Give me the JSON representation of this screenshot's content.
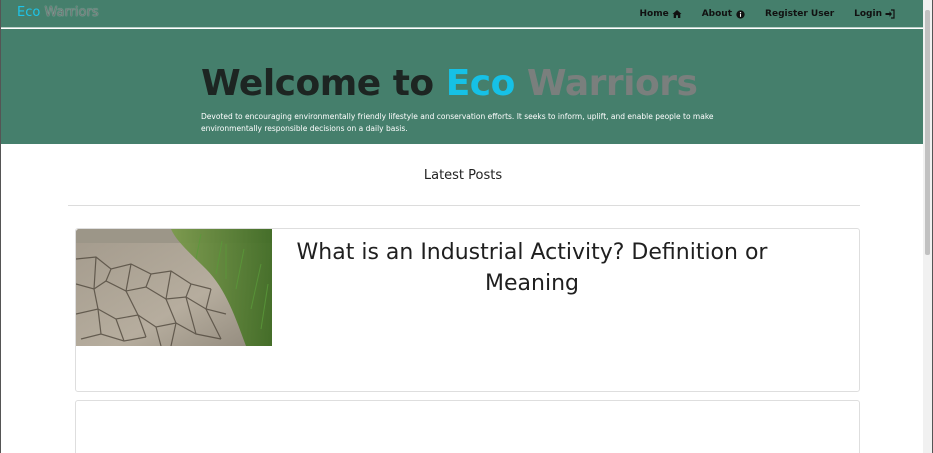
{
  "navbar": {
    "brand_part1": "Eco",
    "brand_part2": "Warriors",
    "links": [
      {
        "label": "Home",
        "icon": "home-icon"
      },
      {
        "label": "About",
        "icon": "info-icon"
      },
      {
        "label": "Register User",
        "icon": ""
      },
      {
        "label": "Login",
        "icon": "login-icon"
      }
    ]
  },
  "hero": {
    "title_part1": "Welcome to",
    "title_part2": "Eco",
    "title_part3": "Warriors",
    "description": "Devoted to encouraging environmentally friendly lifestyle and conservation efforts. It seeks to inform, uplift, and enable people to make environmentally responsible decisions on a daily basis."
  },
  "main": {
    "section_title": "Latest Posts",
    "posts": [
      {
        "title": "What is an Industrial Activity? Definition or Meaning",
        "thumbnail": "cracked-dry-soil-with-grass"
      },
      {
        "title": ""
      }
    ]
  },
  "colors": {
    "navbar_bg": "#457f6c",
    "accent_cyan": "#16c1e6",
    "title_dark": "#1d2522",
    "title_gray": "#7a7f7d"
  }
}
